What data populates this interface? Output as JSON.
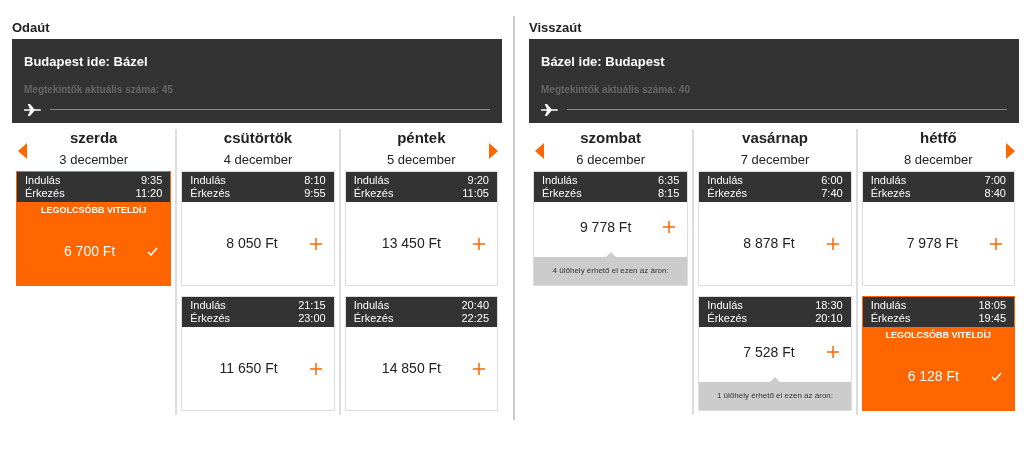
{
  "sections": [
    {
      "title": "Odaút",
      "route": "Budapest ide: Bázel",
      "viewers": "Megtekintők aktuális száma: 45",
      "days": [
        {
          "weekday": "szerda",
          "date": "3 december",
          "flights": [
            {
              "dep_label": "Indulás",
              "dep": "9:35",
              "arr_label": "Érkezés",
              "arr": "11:20",
              "price": "6 700 Ft",
              "selected": true,
              "badge": "LEGOLCSÓBB VITELDÍJ"
            }
          ]
        },
        {
          "weekday": "csütörtök",
          "date": "4 december",
          "flights": [
            {
              "dep_label": "Indulás",
              "dep": "8:10",
              "arr_label": "Érkezés",
              "arr": "9:55",
              "price": "8 050 Ft",
              "selected": false
            },
            {
              "dep_label": "Indulás",
              "dep": "21:15",
              "arr_label": "Érkezés",
              "arr": "23:00",
              "price": "11 650 Ft",
              "selected": false
            }
          ]
        },
        {
          "weekday": "péntek",
          "date": "5 december",
          "flights": [
            {
              "dep_label": "Indulás",
              "dep": "9:20",
              "arr_label": "Érkezés",
              "arr": "11:05",
              "price": "13 450 Ft",
              "selected": false
            },
            {
              "dep_label": "Indulás",
              "dep": "20:40",
              "arr_label": "Érkezés",
              "arr": "22:25",
              "price": "14 850 Ft",
              "selected": false
            }
          ]
        }
      ]
    },
    {
      "title": "Visszaút",
      "route": "Bázel ide: Budapest",
      "viewers": "Megtekintők aktuális száma: 40",
      "days": [
        {
          "weekday": "szombat",
          "date": "6 december",
          "flights": [
            {
              "dep_label": "Indulás",
              "dep": "6:35",
              "arr_label": "Érkezés",
              "arr": "8:15",
              "price": "9 778 Ft",
              "selected": false,
              "seats_note": "4 ülőhely érhető el ezen az áron:"
            }
          ]
        },
        {
          "weekday": "vasárnap",
          "date": "7 december",
          "flights": [
            {
              "dep_label": "Indulás",
              "dep": "6:00",
              "arr_label": "Érkezés",
              "arr": "7:40",
              "price": "8 878 Ft",
              "selected": false
            },
            {
              "dep_label": "Indulás",
              "dep": "18:30",
              "arr_label": "Érkezés",
              "arr": "20:10",
              "price": "7 528 Ft",
              "selected": false,
              "seats_note": "1 ülőhely érhető el ezen az áron:"
            }
          ]
        },
        {
          "weekday": "hétfő",
          "date": "8 december",
          "flights": [
            {
              "dep_label": "Indulás",
              "dep": "7:00",
              "arr_label": "Érkezés",
              "arr": "8:40",
              "price": "7 978 Ft",
              "selected": false
            },
            {
              "dep_label": "Indulás",
              "dep": "18:05",
              "arr_label": "Érkezés",
              "arr": "19:45",
              "price": "6 128 Ft",
              "selected": true,
              "badge": "LEGOLCSÓBB VITELDÍJ"
            }
          ]
        }
      ]
    }
  ]
}
